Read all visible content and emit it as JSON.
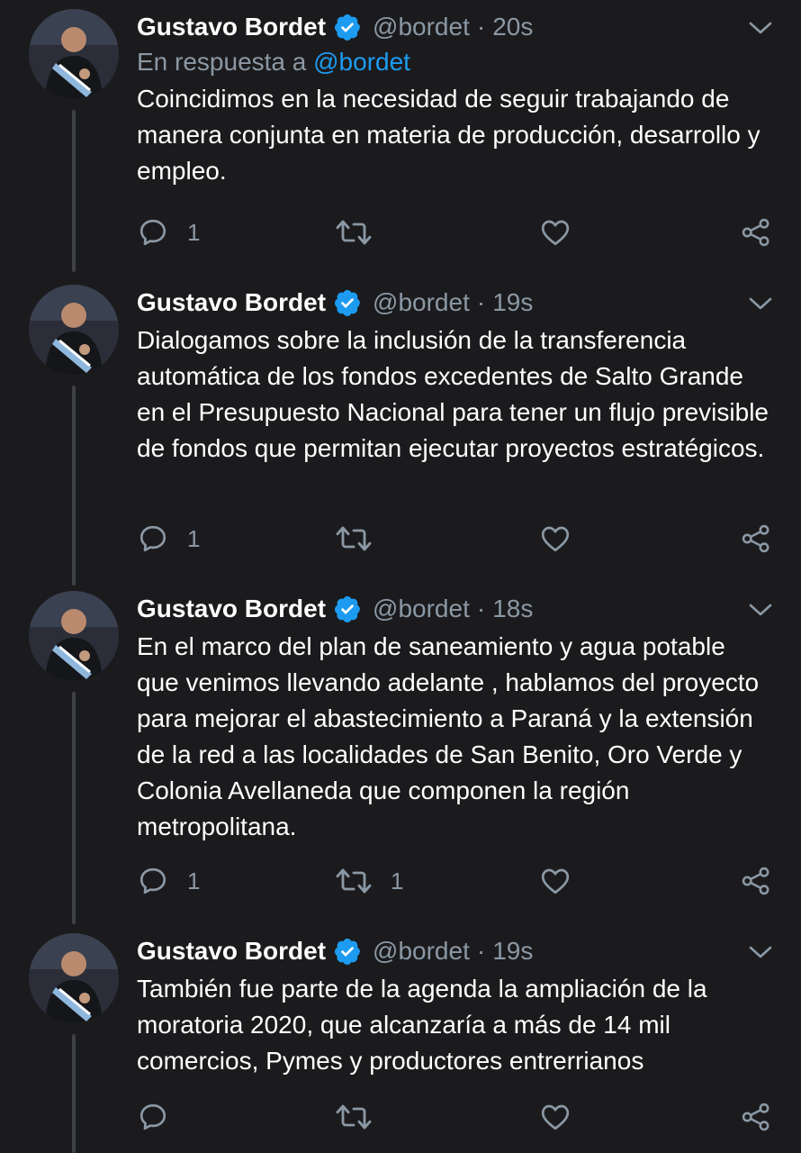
{
  "colors": {
    "background": "#1b1b1d",
    "accent": "#1d9bf0",
    "muted": "#8b98a5",
    "text": "#ffffff"
  },
  "tweets": [
    {
      "name": "Gustavo Bordet",
      "handle": "@bordet",
      "sep": "·",
      "time": "20s",
      "reply_prefix": "En respuesta a",
      "reply_mention": "@bordet",
      "text": "Coincidimos en la necesidad de seguir trabajando de manera conjunta en materia de producción, desarrollo y empleo.",
      "reply_count": "1",
      "retweet_count": "",
      "like_count": ""
    },
    {
      "name": "Gustavo Bordet",
      "handle": "@bordet",
      "sep": "·",
      "time": "19s",
      "text": "Dialogamos sobre la inclusión de la transferencia automática de los fondos excedentes de Salto Grande en el Presupuesto Nacional para tener un flujo previsible de fondos que permitan ejecutar proyectos estratégicos.",
      "reply_count": "1",
      "retweet_count": "",
      "like_count": ""
    },
    {
      "name": "Gustavo Bordet",
      "handle": "@bordet",
      "sep": "·",
      "time": "18s",
      "text": "En el marco del plan de saneamiento y agua potable que venimos llevando adelante , hablamos del proyecto para mejorar el abastecimiento a Paraná y la extensión de la red a las localidades de San Benito, Oro Verde y Colonia Avellaneda que componen la región metropolitana.",
      "reply_count": "1",
      "retweet_count": "1",
      "like_count": ""
    },
    {
      "name": "Gustavo Bordet",
      "handle": "@bordet",
      "sep": "·",
      "time": "19s",
      "text": "También fue parte de la agenda la ampliación de la moratoria 2020, que alcanzaría a más de 14 mil comercios, Pymes y productores entrerrianos",
      "reply_count": "",
      "retweet_count": "",
      "like_count": ""
    }
  ],
  "icons": {
    "verified": "verified-badge-icon",
    "caret": "chevron-down-icon",
    "reply": "reply-icon",
    "retweet": "retweet-icon",
    "like": "heart-icon",
    "share": "share-icon"
  }
}
